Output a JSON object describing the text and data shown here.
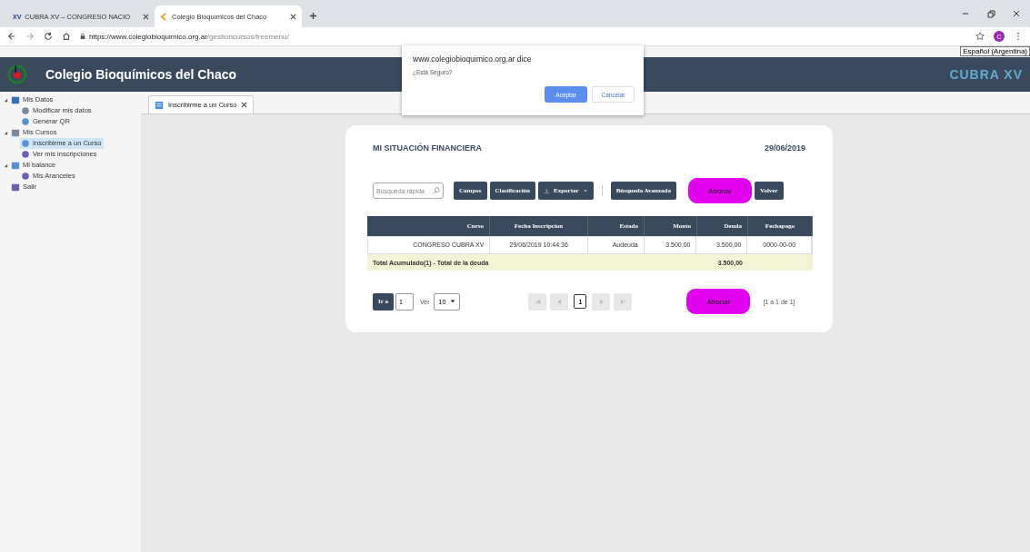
{
  "browser": {
    "tabs": [
      {
        "title": "CUBRA XV – CONGRESO NACIO",
        "badge": "XV",
        "selected": false
      },
      {
        "title": "Colegio Bioquímicos del Chaco",
        "selected": true
      }
    ],
    "url": {
      "host": "https://www.colegiobioquimico.org.ar",
      "path": "/gestioncursos/treemenu/"
    },
    "avatar": "C",
    "tooltip": "Español (Argentina)"
  },
  "header": {
    "title": "Colegio Bioquímicos del Chaco",
    "banner": "CUBRA XV"
  },
  "sidebar": {
    "items": [
      {
        "label": "Mis Datos",
        "expanded": true,
        "selected": false,
        "children": [
          {
            "label": "Modificar mis datos",
            "selected": false
          },
          {
            "label": "Generar QR",
            "selected": false
          }
        ]
      },
      {
        "label": "Mis Cursos",
        "expanded": true,
        "selected": false,
        "children": [
          {
            "label": "Inscribirme a un Curso",
            "selected": true
          },
          {
            "label": "Ver mis inscripciones",
            "selected": false
          }
        ]
      },
      {
        "label": "Mi balance",
        "expanded": true,
        "selected": false,
        "children": [
          {
            "label": "Mis Aranceles",
            "selected": false
          }
        ]
      },
      {
        "label": "Salir",
        "expanded": false,
        "selected": false
      }
    ]
  },
  "content_tabs": [
    {
      "label": "Inscribirme a un Curso",
      "selected": true
    }
  ],
  "card": {
    "title": "MI SITUACIÓN FINANCIERA",
    "date": "29/06/2019",
    "search": {
      "placeholder": "Búsqueda rápida"
    },
    "toolbar": [
      {
        "kind": "button",
        "label": "Campos"
      },
      {
        "kind": "button",
        "label": "Clasificación"
      },
      {
        "kind": "dropdown",
        "label": "Exportar"
      },
      {
        "kind": "separator"
      },
      {
        "kind": "button",
        "label": "Búsqueda Avanzada"
      },
      {
        "kind": "pay",
        "label": "Abonar"
      },
      {
        "kind": "button",
        "label": "Volver"
      }
    ],
    "table": {
      "columns": [
        "Curso",
        "Fecha Inscripcion",
        "Estado",
        "Monto",
        "Deuda",
        "Fechapago"
      ],
      "rows": [
        [
          "CONGRESO CUBRA XV",
          "29/06/2019 10:44:36",
          "Audeuda",
          "3.500,00",
          "3.500,00",
          "0000-00-00"
        ]
      ],
      "total": {
        "label": "Total Acumulado(1) - Total de la deuda",
        "amount": "3.500,00"
      }
    },
    "pager": {
      "goto_label": "Ir a",
      "goto_value": "1",
      "view_label": "Ver",
      "page_size": "10",
      "nav": [
        {
          "kind": "first",
          "disabled": true
        },
        {
          "kind": "prev",
          "disabled": true
        },
        {
          "kind": "page",
          "label": "1",
          "selected": true
        },
        {
          "kind": "next",
          "disabled": true
        },
        {
          "kind": "last",
          "disabled": true
        }
      ],
      "pay_label": "Abonar",
      "range": "[1 a 1 de 1]"
    }
  },
  "dialog": {
    "origin": "www.colegiobioquimico.org.ar dice",
    "message": "¿Está Seguro?",
    "buttons": [
      {
        "label": "Aceptar",
        "kind": "primary"
      },
      {
        "label": "Cancelar",
        "kind": "secondary"
      }
    ]
  }
}
